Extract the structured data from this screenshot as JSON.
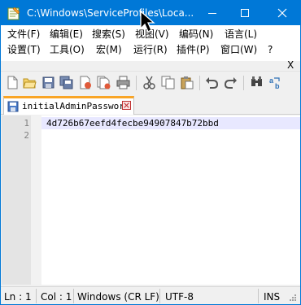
{
  "window": {
    "title": "C:\\Windows\\ServiceProfiles\\Loca...",
    "accent": "#0078d7"
  },
  "menu": {
    "row1": [
      "文件(F)",
      "编辑(E)",
      "搜索(S)",
      "视图(V)",
      "编码(N)",
      "语言(L)"
    ],
    "row2": [
      "设置(T)",
      "工具(O)",
      "宏(M)",
      "运行(R)",
      "插件(P)",
      "窗口(W)",
      "?"
    ],
    "close_doc": "X"
  },
  "toolbar": {
    "icons": [
      "new-file-icon",
      "open-folder-icon",
      "save-icon",
      "save-all-icon",
      "close-icon",
      "close-all-icon",
      "print-icon",
      "cut-icon",
      "copy-icon",
      "paste-icon",
      "undo-icon",
      "redo-icon",
      "find-icon",
      "replace-icon"
    ]
  },
  "tab": {
    "label": "initialAdminPassword",
    "accent": "#f9a526"
  },
  "editor": {
    "line_numbers": [
      "1",
      "2"
    ],
    "lines": [
      "4d726b67eefd4fecbe94907847b72bbd",
      ""
    ]
  },
  "status": {
    "ln": "Ln : 1",
    "col": "Col : 1",
    "eol": "Windows (CR LF)",
    "encoding": "UTF-8",
    "mode": "INS"
  }
}
